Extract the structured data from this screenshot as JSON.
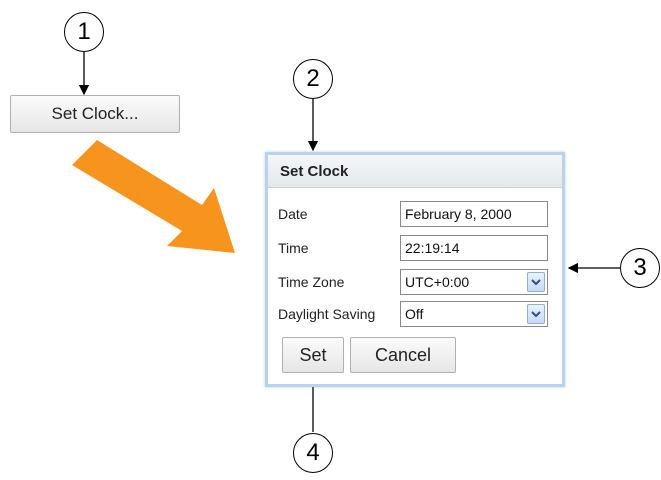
{
  "callouts": [
    "1",
    "2",
    "3",
    "4"
  ],
  "launch_button_label": "Set Clock...",
  "dialog": {
    "title": "Set Clock",
    "fields": [
      {
        "label": "Date",
        "value": "February 8, 2000",
        "type": "text"
      },
      {
        "label": "Time",
        "value": "22:19:14",
        "type": "text"
      },
      {
        "label": "Time Zone",
        "value": "UTC+0:00",
        "type": "select"
      },
      {
        "label": "Daylight Saving",
        "value": "Off",
        "type": "select"
      }
    ],
    "set_label": "Set",
    "cancel_label": "Cancel"
  },
  "colors": {
    "arrow": "#f7941d",
    "dialog_border": "#b9d3ea"
  },
  "icons": {
    "dropdown": "chevron-down-icon",
    "pointer": "arrow-icon"
  }
}
